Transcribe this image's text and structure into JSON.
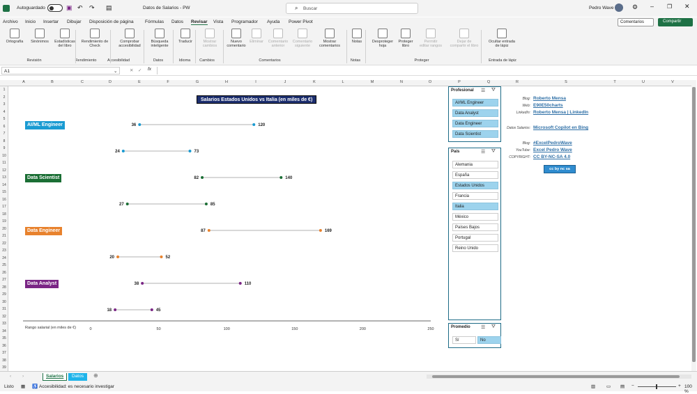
{
  "titlebar": {
    "autosave": "Autoguardado",
    "filename": "Datos de Salarios - PW",
    "search_placeholder": "Buscar",
    "user": "Pedro Wave"
  },
  "menu": [
    "Archivo",
    "Inicio",
    "Insertar",
    "Dibujar",
    "Disposición de página",
    "Fórmulas",
    "Datos",
    "Revisar",
    "Vista",
    "Programador",
    "Ayuda",
    "Power Pivot"
  ],
  "menu_active": "Revisar",
  "comments_btn": "Comentarios",
  "share_btn": "Compartir",
  "ribbon": {
    "items": [
      "Ortografía",
      "Sinónimos",
      "Estadísticas del libro",
      "Rendimiento de Check",
      "Comprobar accesibilidad",
      "Búsqueda inteligente",
      "Traducir",
      "Mostrar cambios",
      "Nuevo comentario",
      "Eliminar",
      "Comentario anterior",
      "Comentario siguiente",
      "Mostrar comentarios",
      "Notas",
      "Desproteger hoja",
      "Proteger libro",
      "Permitir editar rangos",
      "Dejar de compartir el libro",
      "Ocultar entrada de lápiz"
    ],
    "groups": [
      "Revisión",
      "Rendimiento",
      "Accesibilidad",
      "Datos",
      "Idioma",
      "Cambios",
      "Comentarios",
      "Notas",
      "Proteger",
      "Entrada de lápiz"
    ]
  },
  "formula_bar": {
    "name_box": "A1",
    "fx": "fx",
    "content": ""
  },
  "columns": [
    "A",
    "B",
    "C",
    "D",
    "E",
    "F",
    "G",
    "H",
    "I",
    "J",
    "K",
    "L",
    "M",
    "N",
    "O",
    "P",
    "Q",
    "R",
    "S",
    "T",
    "U",
    "V"
  ],
  "rows": [
    "1",
    "2",
    "3",
    "4",
    "5",
    "6",
    "7",
    "8",
    "9",
    "10",
    "11",
    "12",
    "13",
    "14",
    "15",
    "16",
    "17",
    "18",
    "19",
    "20",
    "21",
    "22",
    "23",
    "24",
    "25",
    "26",
    "27",
    "28",
    "29",
    "30",
    "31",
    "32",
    "33",
    "34",
    "35",
    "36",
    "37",
    "38",
    "39"
  ],
  "chart_data": {
    "type": "dumbbell",
    "title": "Salarios Estados Unidos vs Italia (en miles de €)",
    "xlabel": "Rango salarial (en miles de €)",
    "xlim": [
      0,
      250
    ],
    "xticks": [
      "0",
      "50",
      "100",
      "150",
      "200",
      "250"
    ],
    "groups": [
      {
        "name": "AI/ML Engineer",
        "color": "#1a9bd2",
        "pairs": [
          [
            36,
            120
          ],
          [
            24,
            73
          ]
        ]
      },
      {
        "name": "Data Scientist",
        "color": "#1a6e34",
        "pairs": [
          [
            82,
            140
          ],
          [
            27,
            85
          ]
        ]
      },
      {
        "name": "Data Engineer",
        "color": "#e8822d",
        "pairs": [
          [
            87,
            169
          ],
          [
            20,
            52
          ]
        ]
      },
      {
        "name": "Data Analyst",
        "color": "#7a2585",
        "pairs": [
          [
            38,
            110
          ],
          [
            18,
            45
          ]
        ]
      }
    ]
  },
  "slicers": {
    "profesional": {
      "title": "Profesional",
      "items": [
        {
          "label": "AI/ML Engineer",
          "on": true
        },
        {
          "label": "Data Analyst",
          "on": true
        },
        {
          "label": "Data Engineer",
          "on": true
        },
        {
          "label": "Data Scientist",
          "on": true
        }
      ]
    },
    "pais": {
      "title": "País",
      "items": [
        {
          "label": "Alemania",
          "on": false
        },
        {
          "label": "España",
          "on": false
        },
        {
          "label": "Estados Unidos",
          "on": true
        },
        {
          "label": "Francia",
          "on": false
        },
        {
          "label": "Italia",
          "on": true
        },
        {
          "label": "México",
          "on": false
        },
        {
          "label": "Países Bajos",
          "on": false
        },
        {
          "label": "Portugal",
          "on": false
        },
        {
          "label": "Reino Unido",
          "on": false
        }
      ]
    },
    "promedio": {
      "title": "Promedio",
      "items": [
        {
          "label": "Sí",
          "on": false
        },
        {
          "label": "No",
          "on": true
        }
      ]
    }
  },
  "info": [
    {
      "k": "Blog:",
      "v": "Roberto Mensa"
    },
    {
      "k": "Web:",
      "v": "E90E50charts"
    },
    {
      "k": "LinkedIn:",
      "v": "Roberto Mensa | LinkedIn"
    },
    {
      "k": "Datos Salarios:",
      "v": "Microsoft Copilot en Bing"
    },
    {
      "k": "Blog:",
      "v": "#ExcelPedroWave"
    },
    {
      "k": "YouTube:",
      "v": "Excel Pedro Wave"
    },
    {
      "k": "COPYRIGHT:",
      "v": "CC BY-NC-SA 4.0"
    }
  ],
  "license_badge": "cc by nc sa",
  "sheet_tabs": [
    {
      "label": "Salarios",
      "active": true
    },
    {
      "label": "Datos",
      "active": false
    }
  ],
  "status": {
    "ready": "Listo",
    "accessibility": "Accesibilidad: es necesario investigar",
    "zoom": "100 %"
  }
}
